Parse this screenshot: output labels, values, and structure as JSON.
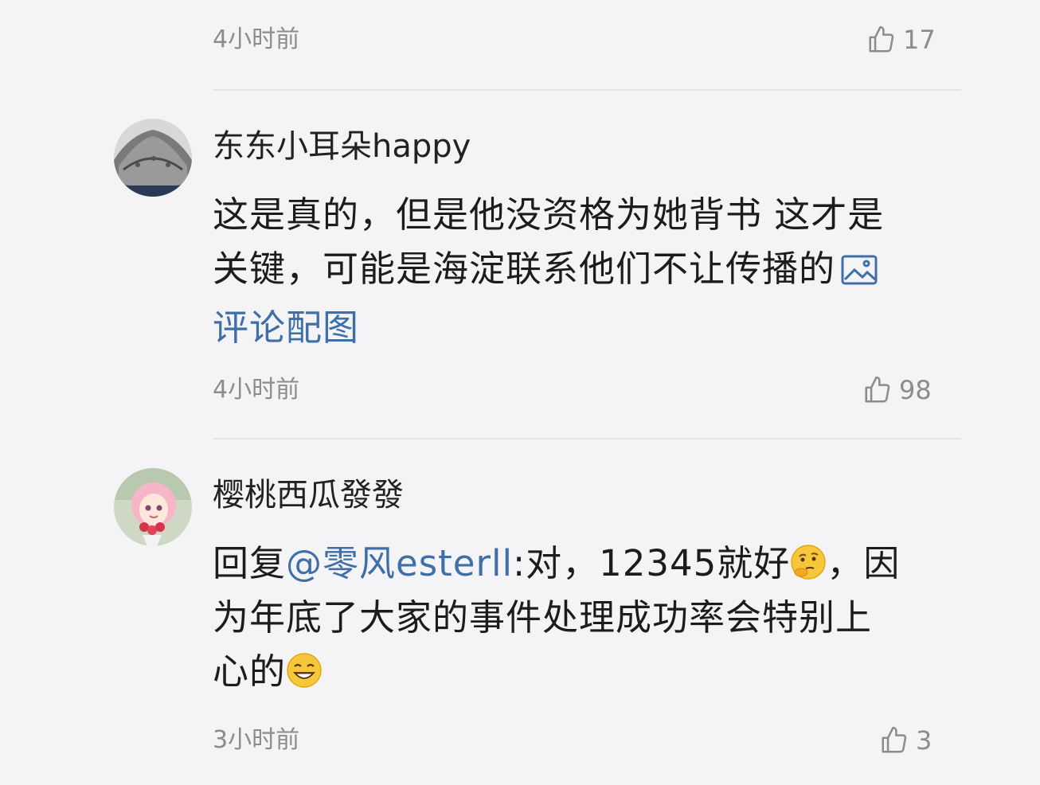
{
  "comments": [
    {
      "time": "4小时前",
      "likes": "17"
    },
    {
      "username": "东东小耳朵happy",
      "text_1": "这是真的，但是他没资格为她背书 这才是",
      "text_2": "关键，可能是海淀联系他们不让传播的",
      "image_link": "评论配图",
      "time": "4小时前",
      "likes": "98"
    },
    {
      "username": "樱桃西瓜發發",
      "reply_prefix": "回复",
      "mention": "@零风esterll",
      "text_1": ":对，12345就好",
      "text_1b": "，因",
      "text_2": "为年底了大家的事件处理成功率会特别上",
      "text_3": "心的",
      "time": "3小时前",
      "likes": "3"
    }
  ],
  "icons": {
    "like": "thumbs-up-icon",
    "image": "image-icon",
    "emoji_thinking": "thinking-face-emoji",
    "emoji_grin": "grinning-face-emoji"
  },
  "colors": {
    "background": "#f4f4f6",
    "link": "#3f6fa8",
    "meta": "#8c8c8c"
  }
}
